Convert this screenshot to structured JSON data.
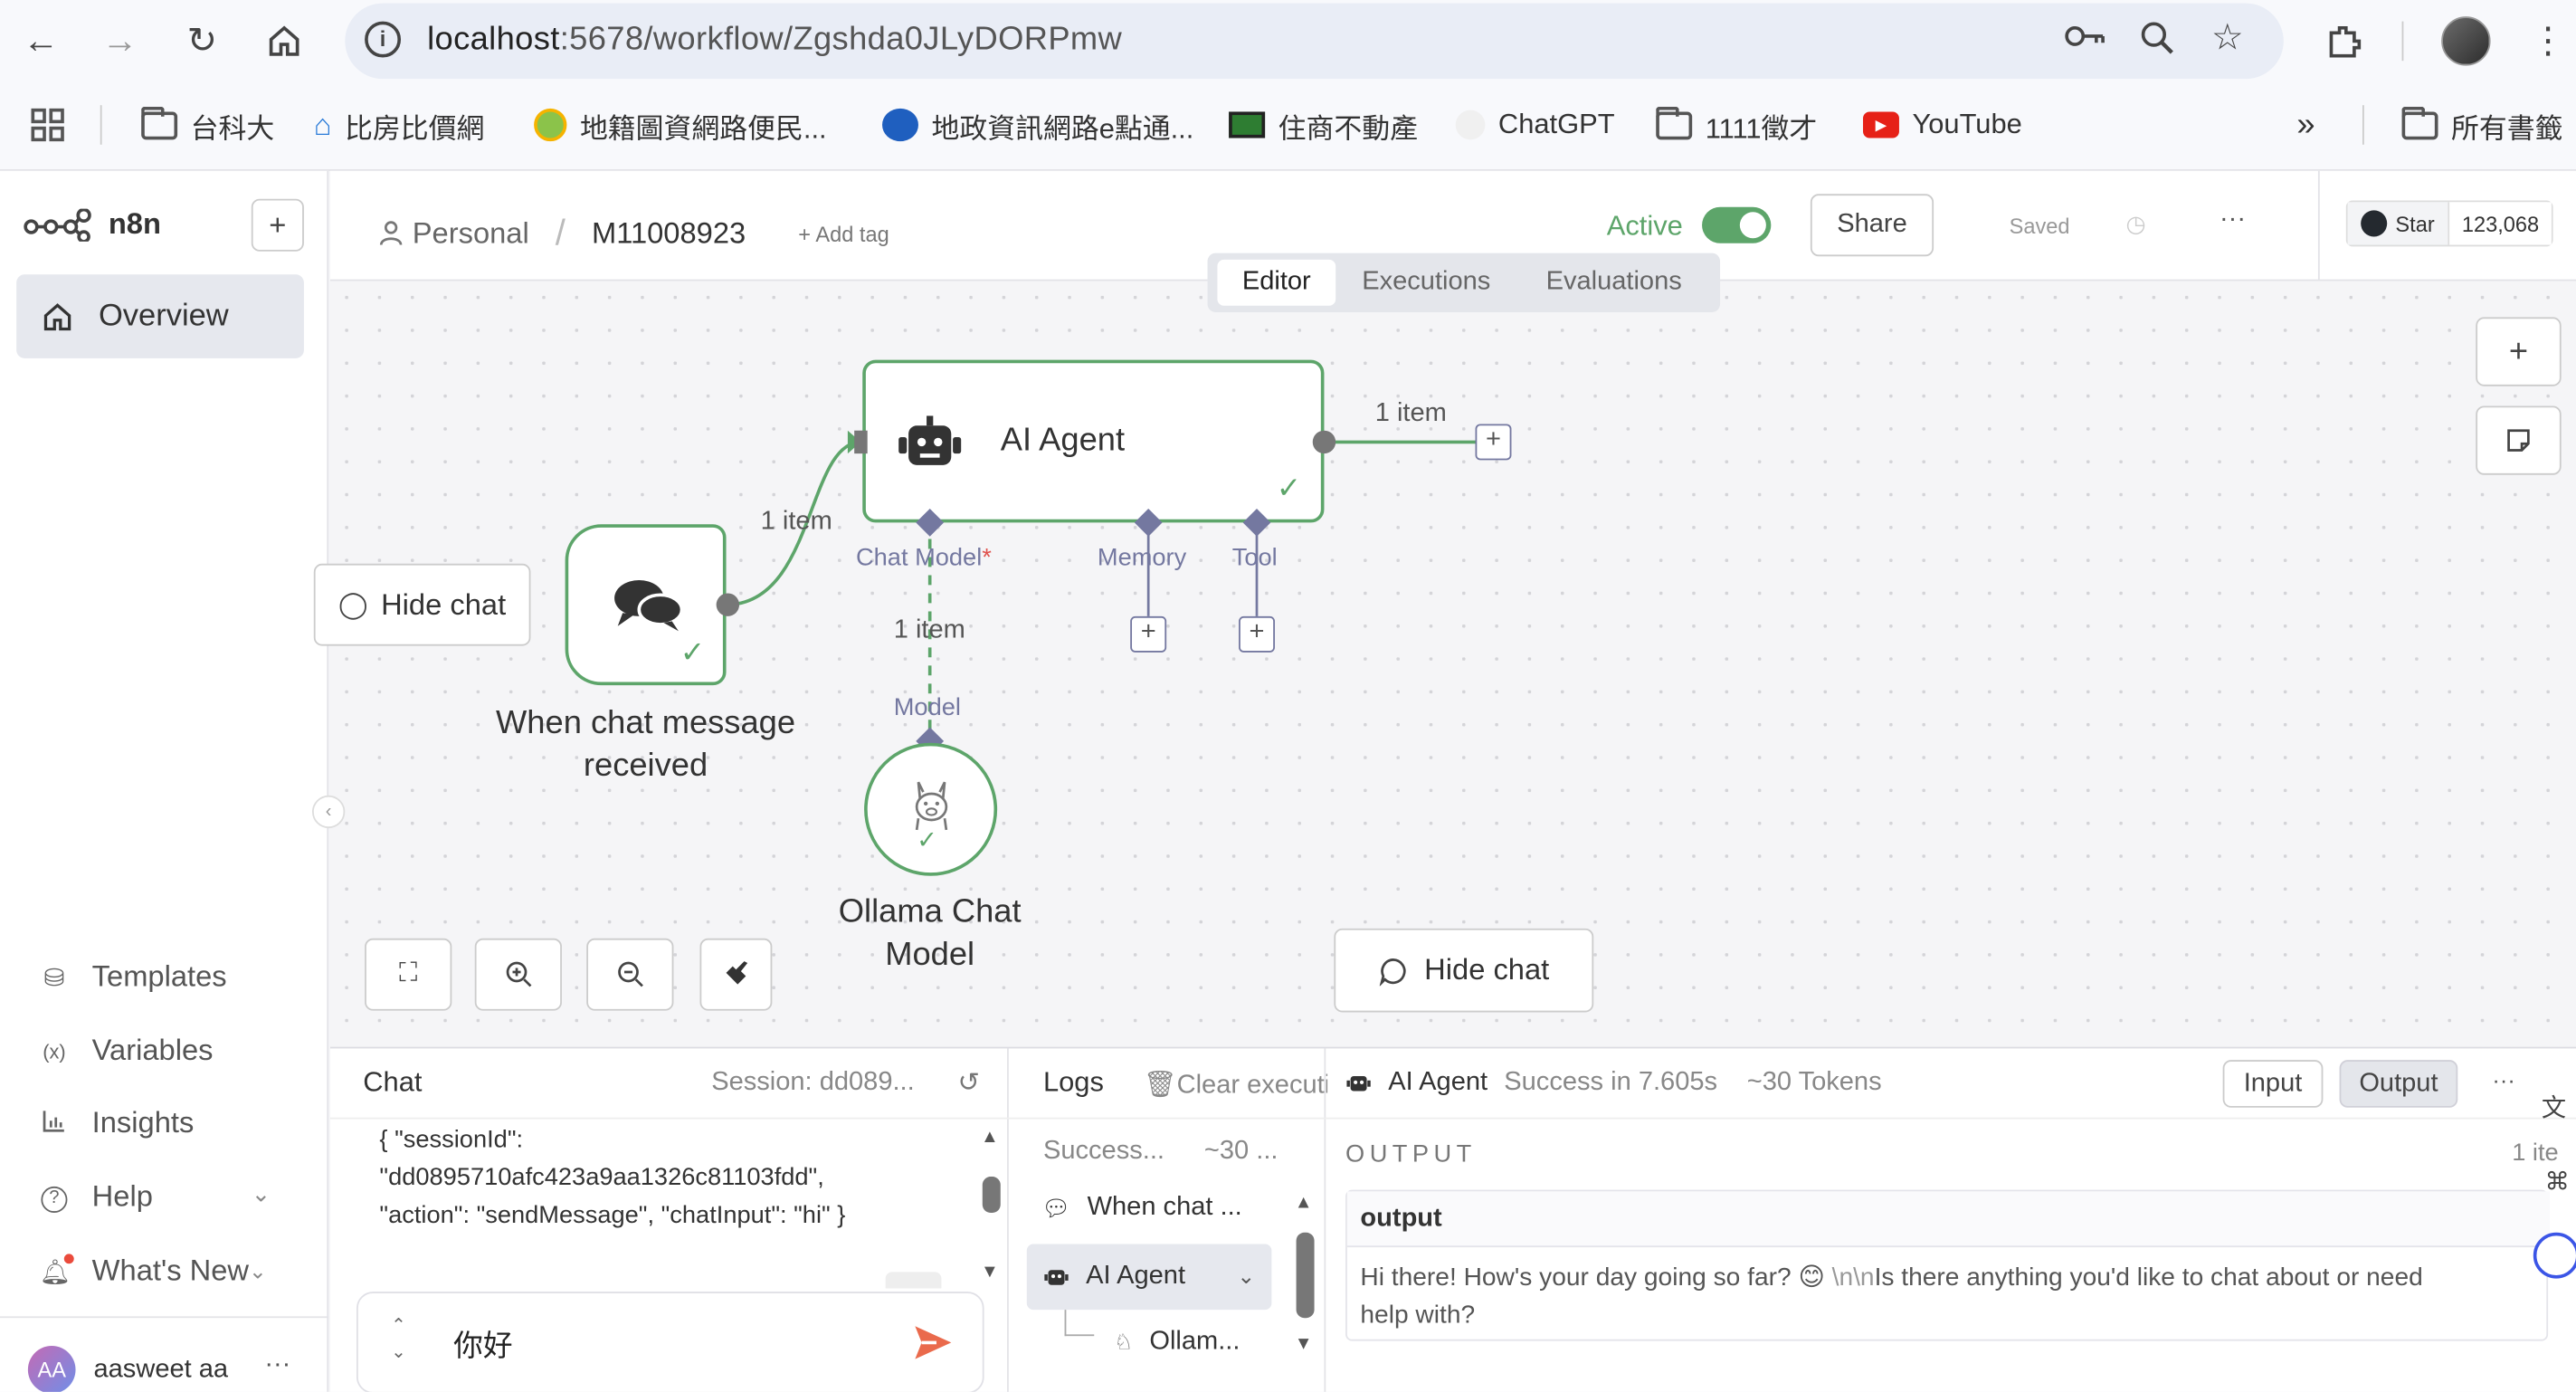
{
  "browser": {
    "url_host": "localhost",
    "url_path": ":5678/workflow/Zgshda0JLyDORPmw",
    "bookmarks": [
      "台科大",
      "比房比價網",
      "地籍圖資網路便民...",
      "地政資訊網路e點通...",
      "住商不動產",
      "ChatGPT",
      "1111徵才",
      "YouTube"
    ],
    "all_bookmarks": "所有書籤",
    "more": "»"
  },
  "sidebar": {
    "brand": "n8n",
    "add": "+",
    "overview": "Overview",
    "bottom_items": [
      {
        "label": "Templates",
        "icon": "templates-icon"
      },
      {
        "label": "Variables",
        "icon": "variables-icon"
      },
      {
        "label": "Insights",
        "icon": "insights-icon"
      },
      {
        "label": "Help",
        "icon": "help-icon"
      },
      {
        "label": "What's New",
        "icon": "bell-icon"
      }
    ],
    "user_initials": "AA",
    "user_name": "aasweet aa",
    "user_more": "···"
  },
  "topbar": {
    "project": "Personal",
    "separator": "/",
    "workflow_name": "M11008923",
    "add_tag": "+ Add tag",
    "active_label": "Active",
    "active": true,
    "share": "Share",
    "saved": "Saved",
    "more": "···",
    "github_star": "Star",
    "github_count": "123,068",
    "tabs": [
      "Editor",
      "Executions",
      "Evaluations"
    ],
    "active_tab": "Editor"
  },
  "canvas": {
    "nodes": {
      "agent": {
        "title": "AI Agent",
        "ports": [
          "Chat Model",
          "Memory",
          "Tool"
        ],
        "required_mark": "*"
      },
      "trigger": {
        "title_line1": "When chat message",
        "title_line2": "received"
      },
      "model": {
        "title_line1": "Ollama Chat",
        "title_line2": "Model",
        "port": "Model"
      }
    },
    "edge_labels": {
      "trigger_to_agent": "1 item",
      "agent_out": "1 item",
      "model_to_agent": "1 item"
    },
    "hide_chat": "Hide chat",
    "hide_chat_left": "Hide chat",
    "zoom_in": "+",
    "plus": "+"
  },
  "chat_panel": {
    "title": "Chat",
    "session": "Session: dd089...",
    "json_line1": "{ \"sessionId\":",
    "json_line2": "\"dd0895710afc423a9aa1326c81103fdd\",",
    "json_line3": "\"action\": \"sendMessage\", \"chatInput\": \"hi\" }",
    "input_value": "你好"
  },
  "logs_panel": {
    "title": "Logs",
    "clear": "Clear executi",
    "summary_status": "Success...",
    "summary_tokens": "~30 ...",
    "items": [
      "When chat ...",
      "AI Agent",
      "Ollam..."
    ]
  },
  "output_panel": {
    "node": "AI Agent",
    "status": "Success in 7.605s",
    "tokens": "~30 Tokens",
    "input_btn": "Input",
    "output_btn": "Output",
    "more": "···",
    "section": "OUTPUT",
    "items_count": "1 ite",
    "field": "output",
    "value_before_emoji": "Hi there! How's your day going so far? ",
    "emoji": "😊",
    "escape": " \\n\\n",
    "value_after": "Is there anything you'd like to chat about or need",
    "value_line2": "help with?"
  }
}
